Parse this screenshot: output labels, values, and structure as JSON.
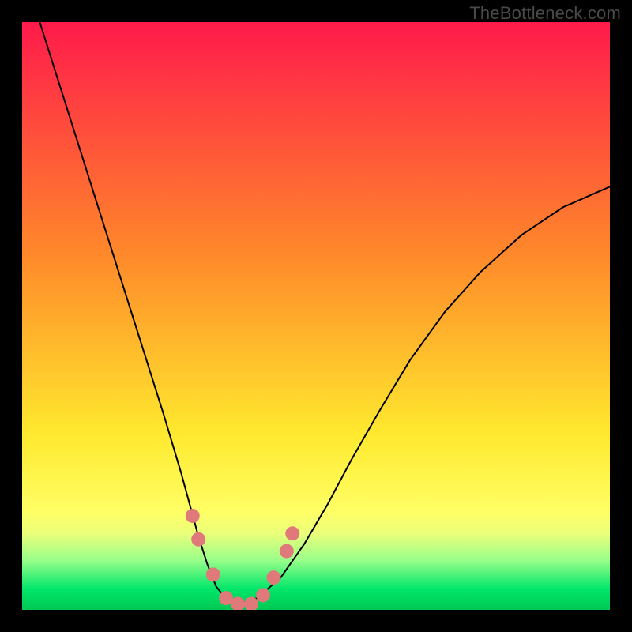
{
  "watermark": "TheBottleneck.com",
  "chart_data": {
    "type": "line",
    "title": "",
    "xlabel": "",
    "ylabel": "",
    "xlim": [
      0,
      1
    ],
    "ylim": [
      0,
      1
    ],
    "background_gradient": {
      "stops": [
        {
          "offset": 0.0,
          "color": "#ff1a4b"
        },
        {
          "offset": 0.4,
          "color": "#ff8a2a"
        },
        {
          "offset": 0.7,
          "color": "#ffe92e"
        },
        {
          "offset": 0.835,
          "color": "#ffff66"
        },
        {
          "offset": 0.87,
          "color": "#eaff7a"
        },
        {
          "offset": 0.915,
          "color": "#9aff8a"
        },
        {
          "offset": 0.965,
          "color": "#00e66a"
        },
        {
          "offset": 1.0,
          "color": "#00c853"
        }
      ]
    },
    "series": [
      {
        "name": "bottleneck-curve",
        "color": "#000000",
        "width": 2,
        "x": [
          0.03,
          0.06,
          0.09,
          0.12,
          0.15,
          0.18,
          0.21,
          0.24,
          0.27,
          0.285,
          0.3,
          0.315,
          0.33,
          0.35,
          0.368,
          0.4,
          0.44,
          0.48,
          0.52,
          0.56,
          0.61,
          0.66,
          0.72,
          0.78,
          0.85,
          0.92,
          1.0
        ],
        "y": [
          1.0,
          0.905,
          0.81,
          0.715,
          0.62,
          0.525,
          0.43,
          0.335,
          0.235,
          0.18,
          0.125,
          0.078,
          0.04,
          0.015,
          0.01,
          0.02,
          0.055,
          0.112,
          0.18,
          0.255,
          0.342,
          0.425,
          0.508,
          0.575,
          0.638,
          0.685,
          0.72
        ]
      }
    ],
    "markers": {
      "color": "#e07a7a",
      "radius_px": 9,
      "points": [
        {
          "x": 0.29,
          "y": 0.16
        },
        {
          "x": 0.3,
          "y": 0.12
        },
        {
          "x": 0.325,
          "y": 0.06
        },
        {
          "x": 0.347,
          "y": 0.02
        },
        {
          "x": 0.367,
          "y": 0.01
        },
        {
          "x": 0.39,
          "y": 0.01
        },
        {
          "x": 0.41,
          "y": 0.025
        },
        {
          "x": 0.428,
          "y": 0.055
        },
        {
          "x": 0.45,
          "y": 0.1
        },
        {
          "x": 0.46,
          "y": 0.13
        }
      ]
    }
  }
}
